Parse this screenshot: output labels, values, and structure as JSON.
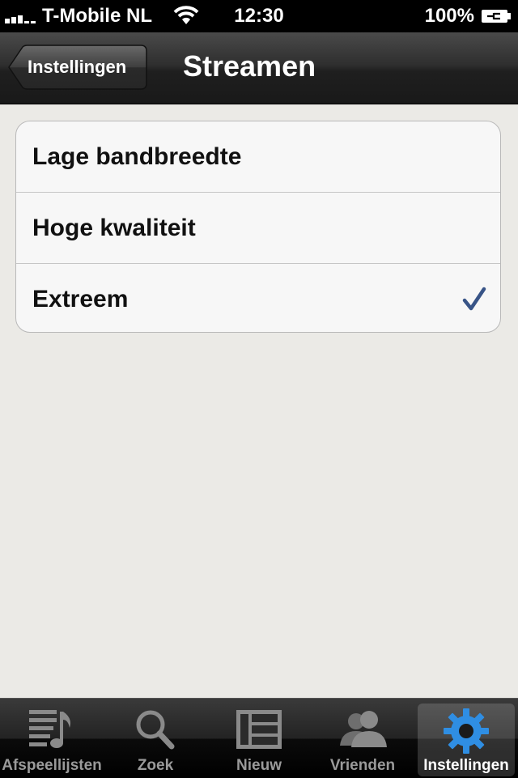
{
  "status_bar": {
    "carrier": "T-Mobile NL",
    "time": "12:30",
    "battery": "100%"
  },
  "nav": {
    "back_label": "Instellingen",
    "title": "Streamen"
  },
  "options": [
    {
      "label": "Lage bandbreedte",
      "selected": false
    },
    {
      "label": "Hoge kwaliteit",
      "selected": false
    },
    {
      "label": "Extreem",
      "selected": true
    }
  ],
  "tabs": [
    {
      "label": "Afspeellijsten",
      "icon": "playlist-icon",
      "active": false
    },
    {
      "label": "Zoek",
      "icon": "search-icon",
      "active": false
    },
    {
      "label": "Nieuw",
      "icon": "news-icon",
      "active": false
    },
    {
      "label": "Vrienden",
      "icon": "friends-icon",
      "active": false
    },
    {
      "label": "Instellingen",
      "icon": "gear-icon",
      "active": true
    }
  ],
  "colors": {
    "checkmark": "#385487",
    "active_tab_icon": "#2f8ee3",
    "background": "#ebeae6"
  }
}
